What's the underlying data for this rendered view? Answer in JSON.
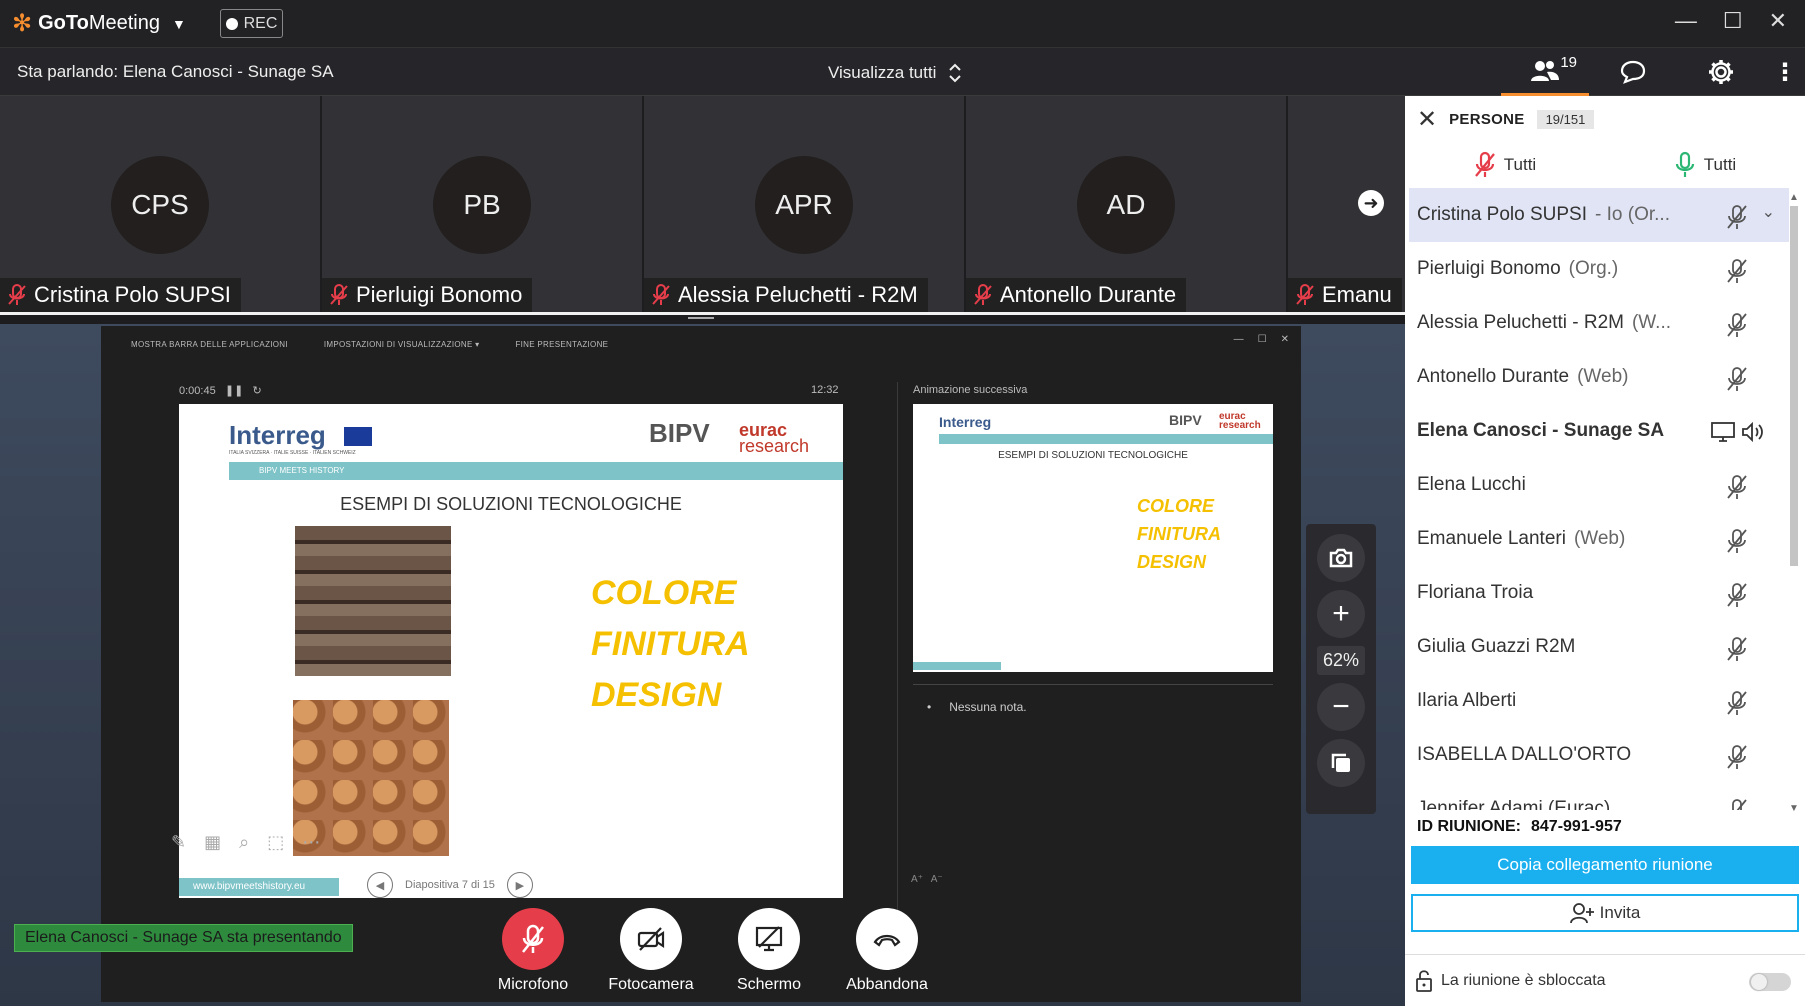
{
  "titlebar": {
    "app_brand_goto": "GoTo",
    "app_brand_meeting": "Meeting",
    "rec_label": "REC"
  },
  "infobar": {
    "speaking": "Sta parlando: Elena Canosci - Sunage SA",
    "view_all": "Visualizza tutti",
    "people_count": "19"
  },
  "video_strip": [
    {
      "initials": "CPS",
      "name": "Cristina Polo SUPSI"
    },
    {
      "initials": "PB",
      "name": "Pierluigi Bonomo"
    },
    {
      "initials": "APR",
      "name": "Alessia Peluchetti - R2M"
    },
    {
      "initials": "AD",
      "name": "Antonello Durante"
    },
    {
      "initials": "",
      "name": "Emanu"
    }
  ],
  "presentation": {
    "toolbar": [
      "MOSTRA BARRA DELLE APPLICAZIONI",
      "IMPOSTAZIONI DI VISUALIZZAZIONE ▾",
      "FINE PRESENTAZIONE"
    ],
    "timer": "0:00:45",
    "clock": "12:32",
    "next_label": "Animazione successiva",
    "notes": "Nessuna nota.",
    "slide_nav": "Diapositiva 7 di 15",
    "slide": {
      "interreg": "Interreg",
      "interreg_sub": "ITALIA SVIZZERA · ITALIE SUISSE · ITALIEN SCHWEIZ",
      "bipv": "BIPV",
      "eurac": "eurac",
      "eurac_sub": "research",
      "bar_text": "BIPV MEETS HISTORY",
      "title": "ESEMPI DI SOLUZIONI TECNOLOGICHE",
      "words": [
        "COLORE",
        "FINITURA",
        "DESIGN"
      ],
      "url": "www.bipvmeetshistory.eu"
    }
  },
  "zoom": {
    "percent": "62%"
  },
  "presenting_banner": "Elena Canosci - Sunage SA sta presentando",
  "call_controls": {
    "mic": "Microfono",
    "camera": "Fotocamera",
    "screen": "Schermo",
    "leave": "Abbandona"
  },
  "panel": {
    "title": "PERSONE",
    "count": "19/151",
    "mute_all": "Tutti",
    "unmute_all": "Tutti",
    "people": [
      {
        "name": "Cristina Polo SUPSI",
        "role": "- Io (Or...",
        "selected": true
      },
      {
        "name": "Pierluigi Bonomo",
        "role": "(Org.)"
      },
      {
        "name": "Alessia Peluchetti - R2M",
        "role": "(W..."
      },
      {
        "name": "Antonello Durante",
        "role": "(Web)"
      },
      {
        "name": "Elena Canosci - Sunage SA",
        "role": "",
        "bold": true,
        "presenter": true
      },
      {
        "name": "Elena Lucchi",
        "role": ""
      },
      {
        "name": "Emanuele Lanteri",
        "role": "(Web)"
      },
      {
        "name": "Floriana Troia",
        "role": ""
      },
      {
        "name": "Giulia Guazzi R2M",
        "role": ""
      },
      {
        "name": "Ilaria Alberti",
        "role": ""
      },
      {
        "name": "ISABELLA DALLO'ORTO",
        "role": ""
      },
      {
        "name": "Jennifer Adami (Eurac)",
        "role": ""
      }
    ],
    "meeting_id_label": "ID RIUNIONE:",
    "meeting_id": "847-991-957",
    "copy_link": "Copia collegamento riunione",
    "invite": "Invita",
    "unlocked": "La riunione è sbloccata"
  },
  "colors": {
    "accent": "#f68d2e",
    "copy_button": "#1ab0f0",
    "mute_red": "#e53e4a",
    "presenting_green": "#2e8b3e",
    "slide_yellow": "#f5c000"
  }
}
